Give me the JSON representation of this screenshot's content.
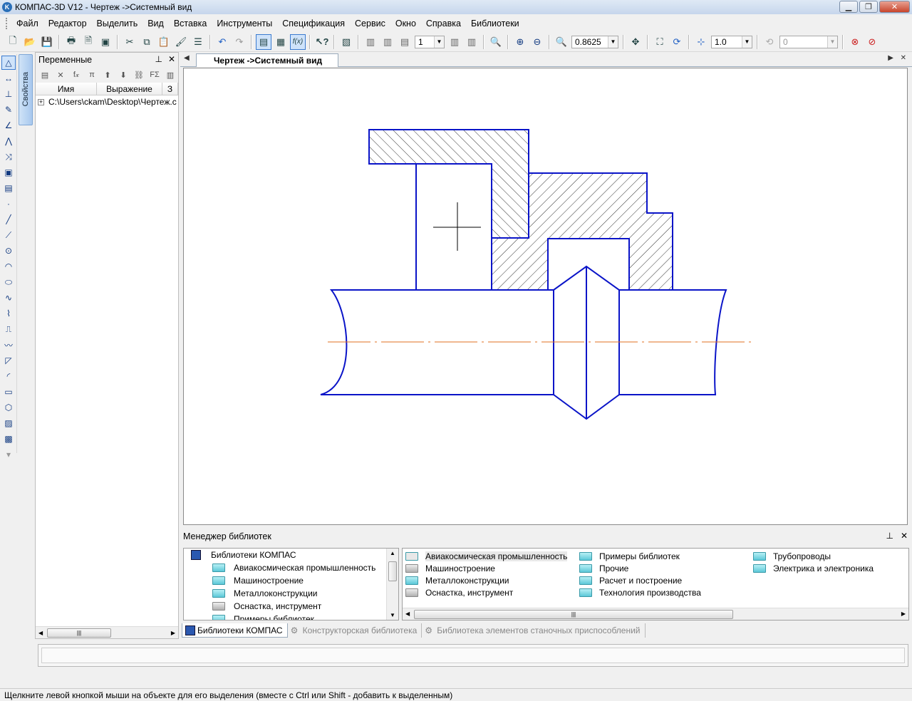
{
  "window": {
    "title": "КОМПАС-3D V12 - Чертеж ->Системный вид",
    "logo_letter": "K"
  },
  "menu": [
    "Файл",
    "Редактор",
    "Выделить",
    "Вид",
    "Вставка",
    "Инструменты",
    "Спецификация",
    "Сервис",
    "Окно",
    "Справка",
    "Библиотеки"
  ],
  "toolbar": {
    "layer_value": "1",
    "zoom_value": "0.8625",
    "step_value": "1.0",
    "angle_value": "0",
    "fx_label": "f(x)"
  },
  "properties_tab": {
    "label": "Свойства"
  },
  "variables_panel": {
    "title": "Переменные",
    "col_name": "Имя",
    "col_expression": "Выражение",
    "col_extra": "З",
    "row_path": "C:\\Users\\ckam\\Desktop\\Чертеж.c",
    "tool_fx": "f𝓍",
    "tool_pi": "π",
    "tool_fs": "FΣ"
  },
  "document_tab": {
    "label": "Чертеж ->Системный вид"
  },
  "drawing": {
    "outline_color": "#0a14c8",
    "axis_color": "#e07020"
  },
  "library_manager": {
    "title": "Менеджер библиотек",
    "tree_root": "Библиотеки КОМПАС",
    "tree_items": [
      {
        "label": "Авиакосмическая промышленность",
        "color": "cyan"
      },
      {
        "label": "Машиностроение",
        "color": "cyan"
      },
      {
        "label": "Металлоконструкции",
        "color": "cyan"
      },
      {
        "label": "Оснастка, инструмент",
        "color": "gray"
      },
      {
        "label": "Примеры библиотек",
        "color": "cyan"
      }
    ],
    "grid_items": [
      {
        "label": "Авиакосмическая промышленность",
        "color": "cyan",
        "selected": true
      },
      {
        "label": "Машиностроение",
        "color": "gray"
      },
      {
        "label": "Металлоконструкции",
        "color": "cyan"
      },
      {
        "label": "Оснастка, инструмент",
        "color": "gray"
      },
      {
        "label": "Примеры библиотек",
        "color": "cyan"
      },
      {
        "label": "Прочие",
        "color": "cyan"
      },
      {
        "label": "Расчет и построение",
        "color": "cyan"
      },
      {
        "label": "Технология производства",
        "color": "cyan"
      },
      {
        "label": "Трубопроводы",
        "color": "cyan"
      },
      {
        "label": "Электрика и электроника",
        "color": "cyan"
      }
    ],
    "tabs": [
      "Библиотеки КОМПАС",
      "Конструкторская библиотека",
      "Библиотека элементов станочных приспособлений"
    ]
  },
  "status": {
    "text": "Щелкните левой кнопкой мыши на объекте для его выделения (вместе с Ctrl или Shift - добавить к выделенным)"
  }
}
